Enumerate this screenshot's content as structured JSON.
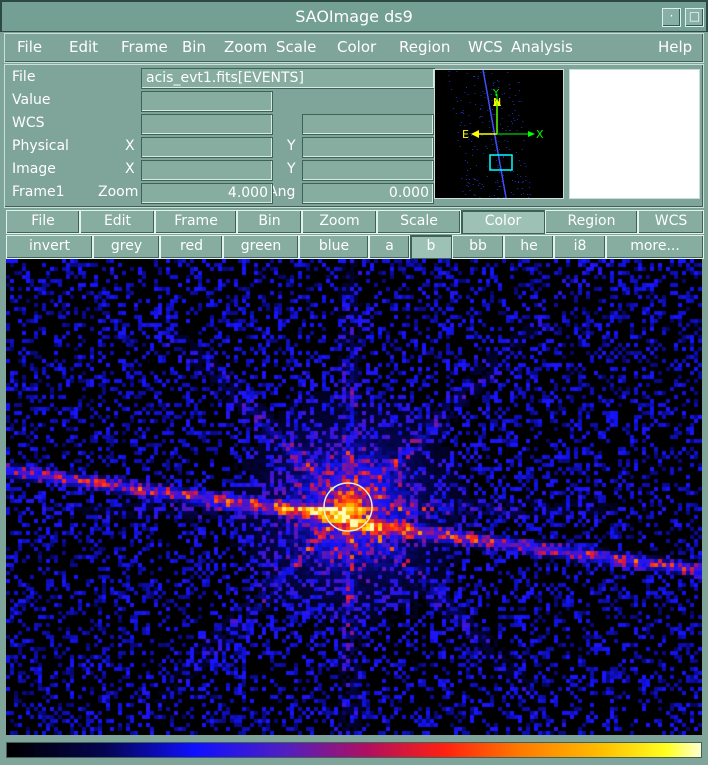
{
  "window": {
    "title": "SAOImage ds9",
    "buttons": [
      "·",
      "□"
    ]
  },
  "menubar": {
    "items": [
      "File",
      "Edit",
      "Frame",
      "Bin",
      "Zoom",
      "Scale",
      "Color",
      "Region",
      "WCS",
      "Analysis"
    ],
    "help": "Help"
  },
  "info": {
    "file_label": "File",
    "file_value": "acis_evt1.fits[EVENTS]",
    "value_label": "Value",
    "wcs_label": "WCS",
    "physical_label": "Physical",
    "image_label": "Image",
    "frame_label": "Frame1",
    "x_label": "X",
    "y_label": "Y",
    "zoom_label": "Zoom",
    "zoom_value": "4.000",
    "ang_label": "Ang",
    "ang_value": "0.000"
  },
  "panner": {
    "north": "N",
    "y_axis": "Y",
    "east": "E",
    "x_axis": "X",
    "compass_color": "#ffff00",
    "axes_color": "#00ff00",
    "box_color": "#00ffff"
  },
  "button_bar": {
    "main": [
      "File",
      "Edit",
      "Frame",
      "Bin",
      "Zoom",
      "Scale",
      "Color",
      "Region",
      "WCS"
    ],
    "active_main": "Color",
    "color_options": [
      "invert",
      "grey",
      "red",
      "green",
      "blue",
      "a",
      "b",
      "bb",
      "he",
      "i8",
      "more..."
    ],
    "active_color": "b"
  },
  "colors": {
    "chrome": "#7fa59a",
    "image_bg": "#000000",
    "region_circle": "#e8f0d8"
  }
}
